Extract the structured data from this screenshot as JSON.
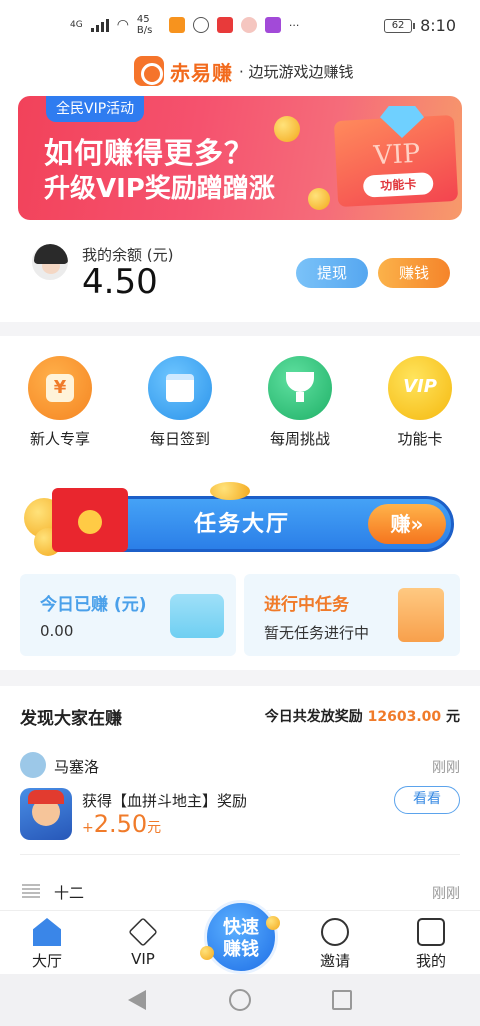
{
  "status_bar": {
    "network": "4G",
    "speed": "45 B/s",
    "battery": "62",
    "time": "8:10",
    "more": "···"
  },
  "header": {
    "brand_name": "赤易赚",
    "slogan": "· 边玩游戏边赚钱"
  },
  "banner": {
    "tag": "全民VIP活动",
    "line1": "如何赚得更多？",
    "line2": "升级VIP奖励蹭蹭涨",
    "card_vip": "VIP",
    "card_label": "功能卡"
  },
  "balance": {
    "label": "我的余额 (元)",
    "value": "4.50",
    "withdraw_label": "提现",
    "earn_label": "赚钱"
  },
  "menu": [
    {
      "label": "新人专享",
      "icon": "money-bag-icon",
      "color": "#f8922e"
    },
    {
      "label": "每日签到",
      "icon": "calendar-icon",
      "color": "#3aa6f2"
    },
    {
      "label": "每周挑战",
      "icon": "trophy-icon",
      "color": "#2ac07a"
    },
    {
      "label": "功能卡",
      "icon": "vip-icon",
      "color": "#f5c21a"
    }
  ],
  "task_hall": {
    "title": "任务大厅",
    "button": "赚»"
  },
  "stats": {
    "today_title": "今日已赚 (元)",
    "today_value": "0.00",
    "progress_title": "进行中任务",
    "progress_value": "暂无任务进行中"
  },
  "feed": {
    "title": "发现大家在赚",
    "summary_prefix": "今日共发放奖励",
    "summary_amount": "12603.00",
    "summary_unit": "元",
    "items": [
      {
        "user": "马塞洛",
        "time": "刚刚",
        "reward_text": "获得【血拼斗地主】奖励",
        "amount_prefix": "+",
        "amount": "2.50",
        "amount_unit": "元",
        "button": "看看"
      },
      {
        "user": "十二",
        "time": "刚刚"
      }
    ]
  },
  "tabbar": {
    "tabs": [
      {
        "label": "大厅",
        "icon": "home-icon",
        "active": true
      },
      {
        "label": "VIP",
        "icon": "vip-diamond-icon",
        "active": false
      },
      {
        "label": "邀请",
        "icon": "invite-icon",
        "active": false
      },
      {
        "label": "我的",
        "icon": "profile-icon",
        "active": false
      }
    ],
    "fab_label_1": "快速",
    "fab_label_2": "赚钱"
  },
  "colors": {
    "accent_orange": "#f07b2a",
    "accent_blue": "#3a8be3",
    "brand": "#f26a1c"
  }
}
